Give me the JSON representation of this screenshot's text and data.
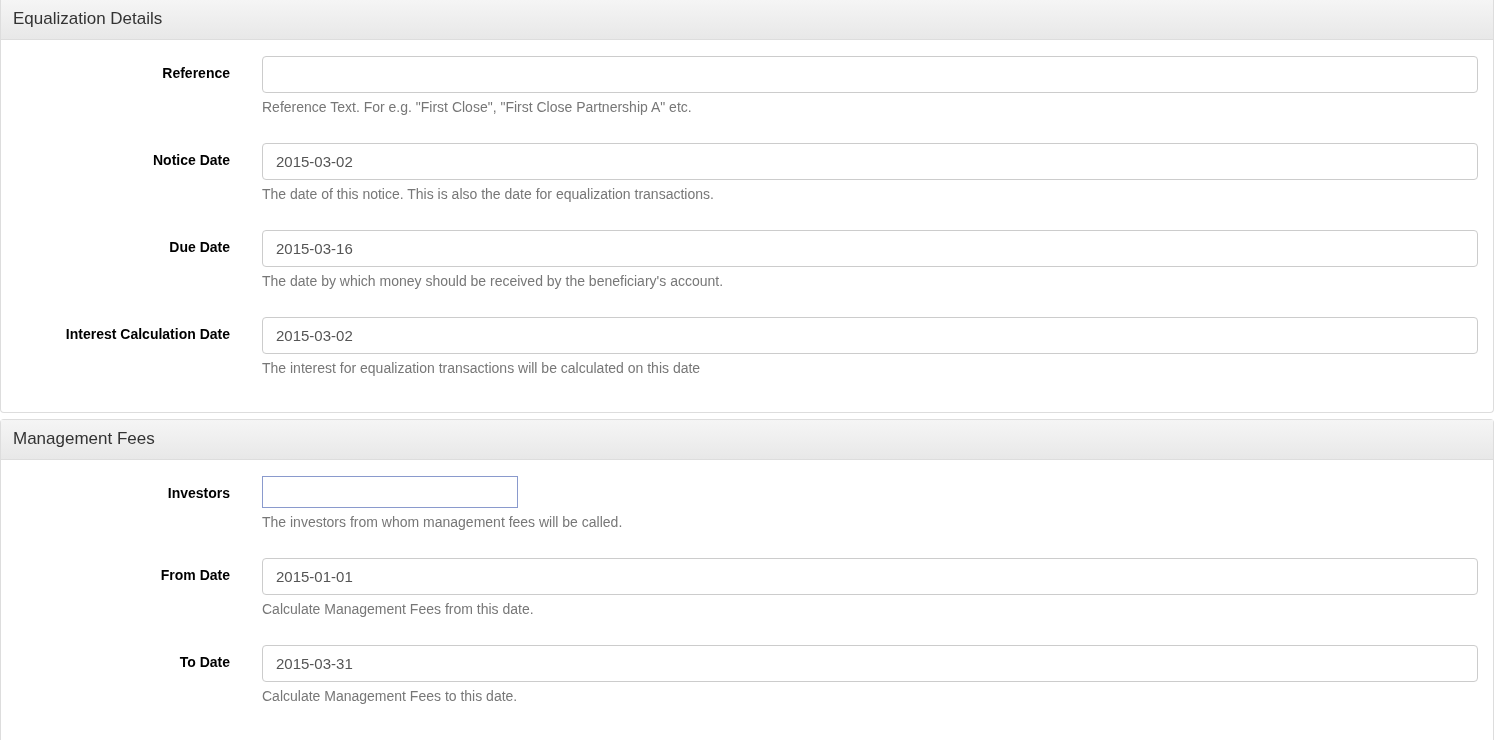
{
  "panels": [
    {
      "title": "Equalization Details",
      "fields": [
        {
          "kind": "text",
          "label": "Reference",
          "help": "Reference Text. For e.g. \"First Close\", \"First Close Partnership A\" etc."
        },
        {
          "kind": "text",
          "label": "Notice Date",
          "value": "2015-03-02",
          "help": "The date of this notice. This is also the date for equalization transactions."
        },
        {
          "kind": "text",
          "label": "Due Date",
          "value": "2015-03-16",
          "help": "The date by which money should be received by the beneficiary's account."
        },
        {
          "kind": "text",
          "label": "Interest Calculation Date",
          "value": "2015-03-02",
          "help": "The interest for equalization transactions will be calculated on this date"
        }
      ]
    },
    {
      "title": "Management Fees",
      "fields": [
        {
          "kind": "picker",
          "label": "Investors",
          "help": "The investors from whom management fees will be called."
        },
        {
          "kind": "text",
          "label": "From Date",
          "value": "2015-01-01",
          "help": "Calculate Management Fees from this date."
        },
        {
          "kind": "text",
          "label": "To Date",
          "value": "2015-03-31",
          "help": "Calculate Management Fees to this date."
        }
      ]
    }
  ]
}
